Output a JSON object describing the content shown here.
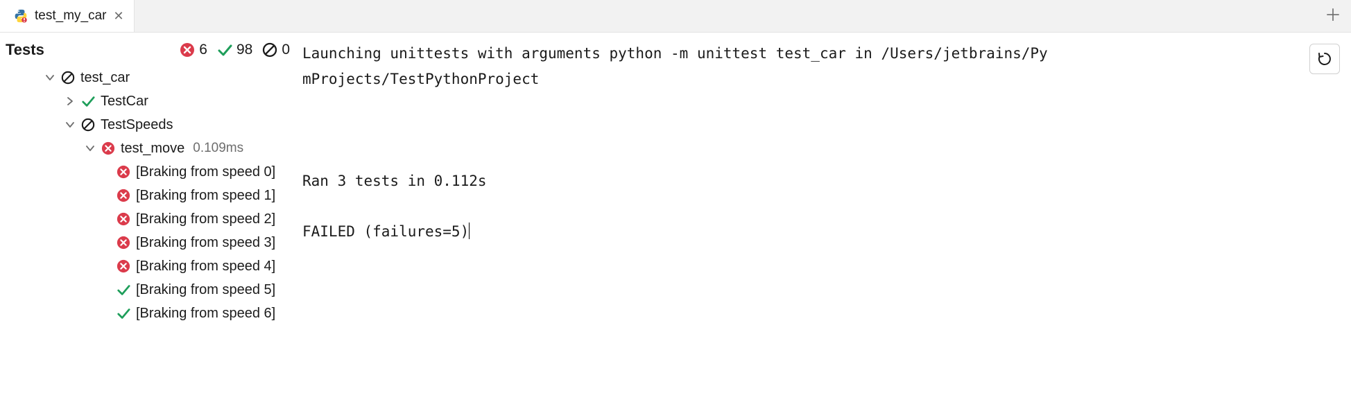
{
  "tab": {
    "label": "test_my_car"
  },
  "tests_header": {
    "title": "Tests"
  },
  "counts": {
    "failed": "6",
    "passed": "98",
    "ignored": "0"
  },
  "tree": {
    "root": {
      "label": "test_car"
    },
    "class_pass": {
      "label": "TestCar"
    },
    "class_ign": {
      "label": "TestSpeeds"
    },
    "test_move": {
      "label": "test_move",
      "duration": "0.109ms"
    },
    "subs": [
      {
        "label": "[Braking from speed 0]",
        "status": "fail"
      },
      {
        "label": "[Braking from speed 1]",
        "status": "fail"
      },
      {
        "label": "[Braking from speed 2]",
        "status": "fail"
      },
      {
        "label": "[Braking from speed 3]",
        "status": "fail"
      },
      {
        "label": "[Braking from speed 4]",
        "status": "fail"
      },
      {
        "label": "[Braking from speed 5]",
        "status": "pass"
      },
      {
        "label": "[Braking from speed 6]",
        "status": "pass"
      }
    ]
  },
  "console": {
    "line1": "Launching unittests with arguments python -m unittest test_car in /Users/jetbrains/Py",
    "line1b": "mProjects/TestPythonProject",
    "blank": "",
    "line2": "Ran 3 tests in 0.112s",
    "line3": "FAILED (failures=5)"
  },
  "colors": {
    "fail": "#db3b4b",
    "pass": "#1e9e5a",
    "ignore": "#1b1b1b"
  }
}
